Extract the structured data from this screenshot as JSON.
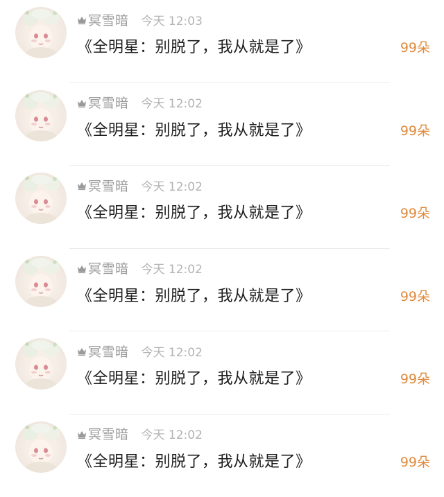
{
  "comments": [
    {
      "username": "冥雪暗",
      "time": "今天 12:03",
      "message": "《全明星：别脱了，我从就是了》",
      "flowers": "99朵"
    },
    {
      "username": "冥雪暗",
      "time": "今天 12:02",
      "message": "《全明星：别脱了，我从就是了》",
      "flowers": "99朵"
    },
    {
      "username": "冥雪暗",
      "time": "今天 12:02",
      "message": "《全明星：别脱了，我从就是了》",
      "flowers": "99朵"
    },
    {
      "username": "冥雪暗",
      "time": "今天 12:02",
      "message": "《全明星：别脱了，我从就是了》",
      "flowers": "99朵"
    },
    {
      "username": "冥雪暗",
      "time": "今天 12:02",
      "message": "《全明星：别脱了，我从就是了》",
      "flowers": "99朵"
    },
    {
      "username": "冥雪暗",
      "time": "今天 12:02",
      "message": "《全明星：别脱了，我从就是了》",
      "flowers": "99朵"
    }
  ],
  "icons": {
    "badge": "crown-icon",
    "avatar": "avatar-illustration"
  },
  "colors": {
    "username": "#9a9a9a",
    "time": "#b3b3b3",
    "message": "#1e1e1e",
    "flowers": "#e08a3c",
    "divider": "#ececec"
  }
}
